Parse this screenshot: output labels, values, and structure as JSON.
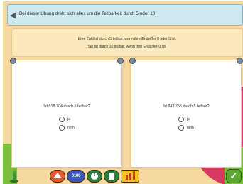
{
  "header": {
    "back_icon": "triangle-left-icon",
    "instruction": "Bei dieser Übung dreht sich alles um die Teilbarkeit durch 5 oder 10."
  },
  "rules": {
    "line1": "Eine Zahl ist durch 5 teilbar, wenn ihre Endziffer 0 oder 5 ist.",
    "line2": "Sie ist durch 10 teilbar, wenn ihre Endziffer 0 ist."
  },
  "cards": [
    {
      "question": "Ist 518 704 durch 5 teilbar?",
      "options": [
        "ja",
        "nein"
      ]
    },
    {
      "question": "Ist 843 755 durch 5 teilbar?",
      "options": [
        "ja",
        "nein"
      ]
    }
  ],
  "toolbar": {
    "counter_label": "0100",
    "icons": [
      "home-icon",
      "eraser-icon",
      "counter-icon",
      "timer-icon",
      "sheet-icon",
      "chart-icon",
      "check-icon"
    ]
  },
  "colors": {
    "header_bg": "#cfe9f1",
    "rules_bg": "#fbe8bd",
    "app_bg": "#f6d9a0",
    "accent_red": "#d63a64",
    "accent_green": "#7bbf3a"
  }
}
